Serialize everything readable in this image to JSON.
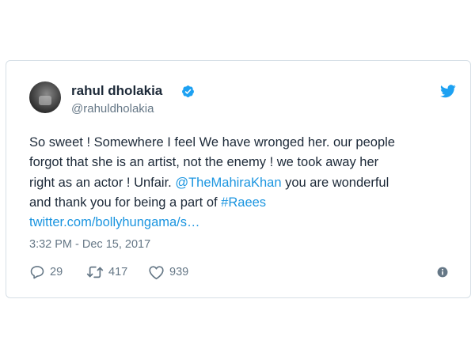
{
  "tweet": {
    "display_name": "rahul dholakia",
    "handle": "@rahuldholakia",
    "lines": [
      [
        {
          "t": "So sweet ! Somewhere I feel We have wronged her. our people",
          "c": "text"
        }
      ],
      [
        {
          "t": "forgot that she is an artist, not the enemy ! we took away her",
          "c": "text"
        }
      ],
      [
        {
          "t": "right as an actor ! Unfair. ",
          "c": "text"
        },
        {
          "t": "@TheMahiraKhan",
          "c": "link"
        },
        {
          "t": " you are wonderful",
          "c": "text"
        }
      ],
      [
        {
          "t": "and thank you for being a part of ",
          "c": "text"
        },
        {
          "t": "#Raees",
          "c": "link"
        }
      ],
      [
        {
          "t": "twitter.com/bollyhungama/s…",
          "c": "link"
        }
      ]
    ],
    "timestamp": "3:32 PM - Dec 15, 2017",
    "replies": "29",
    "retweets": "417",
    "likes": "939"
  },
  "icons": {
    "verified": "verified-badge-icon",
    "twitter": "twitter-bird-icon",
    "reply": "reply-icon",
    "retweet": "retweet-icon",
    "like": "heart-icon",
    "info": "info-icon"
  },
  "colors": {
    "link": "#1b95e0",
    "text": "#1c2938",
    "muted": "#657786",
    "border": "#d6dfe6"
  }
}
